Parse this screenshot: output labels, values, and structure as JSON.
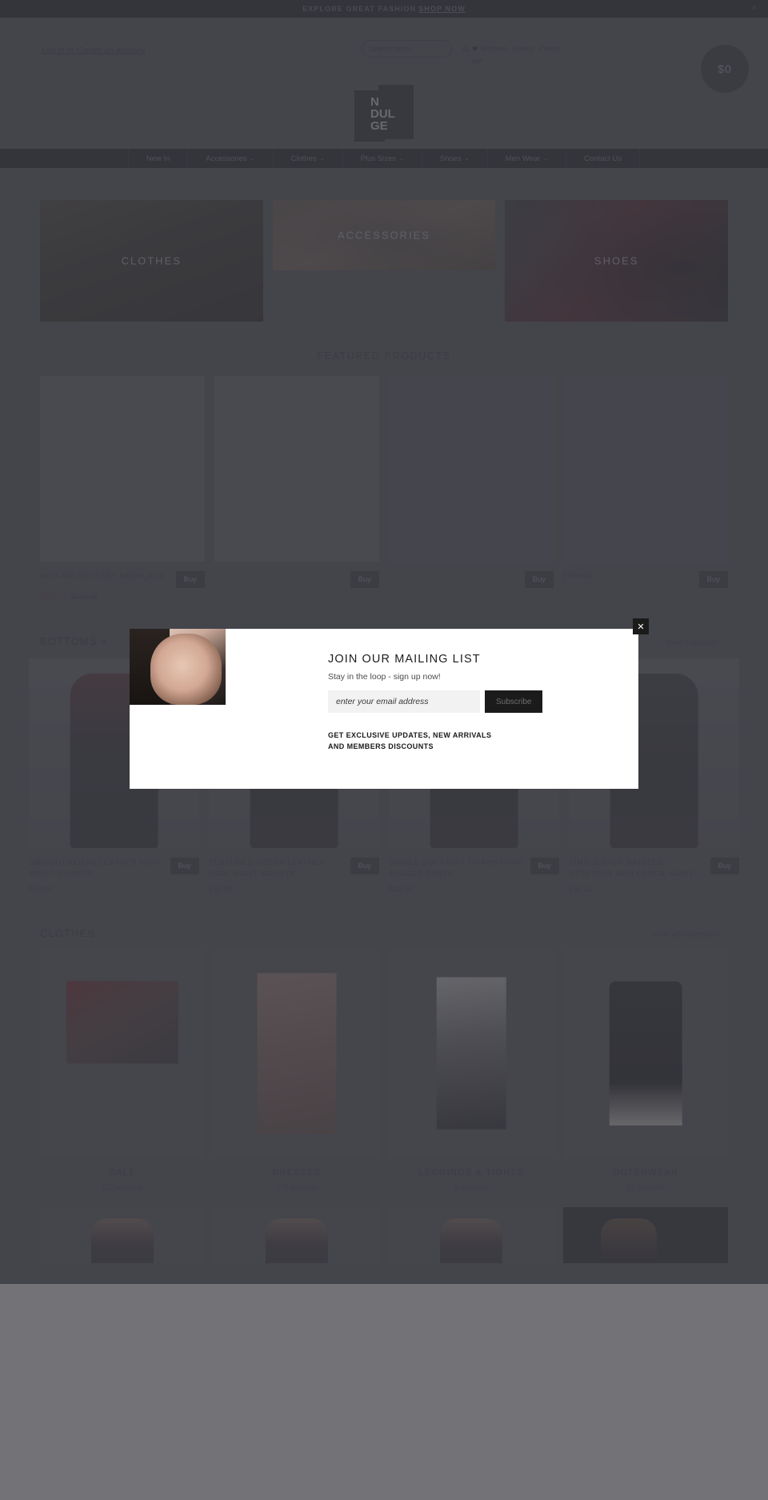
{
  "announcement": {
    "text": "EXPLORE GREAT FASHION",
    "link_label": "SHOP NOW",
    "close_label": "×"
  },
  "utility": {
    "account_link": "Log in or Create an account",
    "search_placeholder": "Search store...",
    "search_value": "",
    "search_icon": "search-icon",
    "wishlist_icon": "heart-icon",
    "wishlist_label": "Wishlist",
    "wishlist_count": "0 item",
    "checkout_label": "Check out",
    "cart_total": "$0"
  },
  "brand": {
    "logo_text": "NDULGE",
    "logo_lines": [
      "N",
      "DUL",
      "GE"
    ]
  },
  "nav": {
    "items": [
      {
        "label": "New In",
        "caret": ""
      },
      {
        "label": "Accessories",
        "caret": "⌄"
      },
      {
        "label": "Clothes",
        "caret": "⌄"
      },
      {
        "label": "Plus Sizes",
        "caret": "⌄"
      },
      {
        "label": "Shoes",
        "caret": "⌄"
      },
      {
        "label": "Men Wear",
        "caret": "⌄"
      },
      {
        "label": "Contact Us",
        "caret": ""
      }
    ]
  },
  "tiles": [
    {
      "label": "CLOTHES"
    },
    {
      "label": "ACCESSORIES"
    },
    {
      "label": "SHOES"
    }
  ],
  "featured": {
    "title": "FEATURED PRODUCTS",
    "buy_label": "Buy",
    "products": [
      {
        "name": "NDULGE ODYSSEY NECKLACE",
        "sale_price": "$129.00",
        "old_price": "$165.00"
      },
      {
        "name": "",
        "sale_price": "",
        "old_price": ""
      },
      {
        "name": "",
        "sale_price": "",
        "old_price": ""
      },
      {
        "name": "FRINGE",
        "sale_price": "",
        "old_price": ""
      }
    ]
  },
  "bottoms": {
    "title": "BOTTOMS +",
    "link": "View Collection →",
    "buy_label": "Buy",
    "products": [
      {
        "name": "SMOOTH VEGAN LEATHER HIGH WAIST SHORTS",
        "price": "$33.93"
      },
      {
        "name": "TEXTURED VEGAN LEATHER HIGH WAIST SHORTS",
        "price": "$33.93"
      },
      {
        "name": "SIMPLE SOFT KNIT DRAWSTRING JOGGER PANTS",
        "price": "$28.34"
      },
      {
        "name": "SIMPLE HIGH WAISTED STRETCHY MIDI PENCIL SKIRT",
        "price": "$32.11"
      }
    ]
  },
  "clothes": {
    "title": "CLOTHES",
    "link": "View all Collections →",
    "collections": [
      {
        "name": "SALE",
        "count": "122 products"
      },
      {
        "name": "DRESSES",
        "count": "179 products"
      },
      {
        "name": "LEGGINGS & TIGHTS",
        "count": "8 products"
      },
      {
        "name": "OUTERWEAR",
        "count": "22 products"
      }
    ]
  },
  "modal": {
    "title": "JOIN OUR MAILING LIST",
    "subtitle": "Stay in the loop - sign up now!",
    "email_placeholder": "enter your email address",
    "email_value": "",
    "subscribe_label": "Subscribe",
    "note_line1": "GET EXCLUSIVE UPDATES, NEW ARRIVALS",
    "note_line2": "AND MEMBERS DISCOUNTS",
    "close_label": "✕"
  },
  "colors": {
    "announce_bg": "#22232a",
    "utility_bg": "#5a5b63",
    "nav_bg": "#22232a",
    "accent_dark": "#1b1b1b",
    "sale_price": "#6e4a4c"
  }
}
